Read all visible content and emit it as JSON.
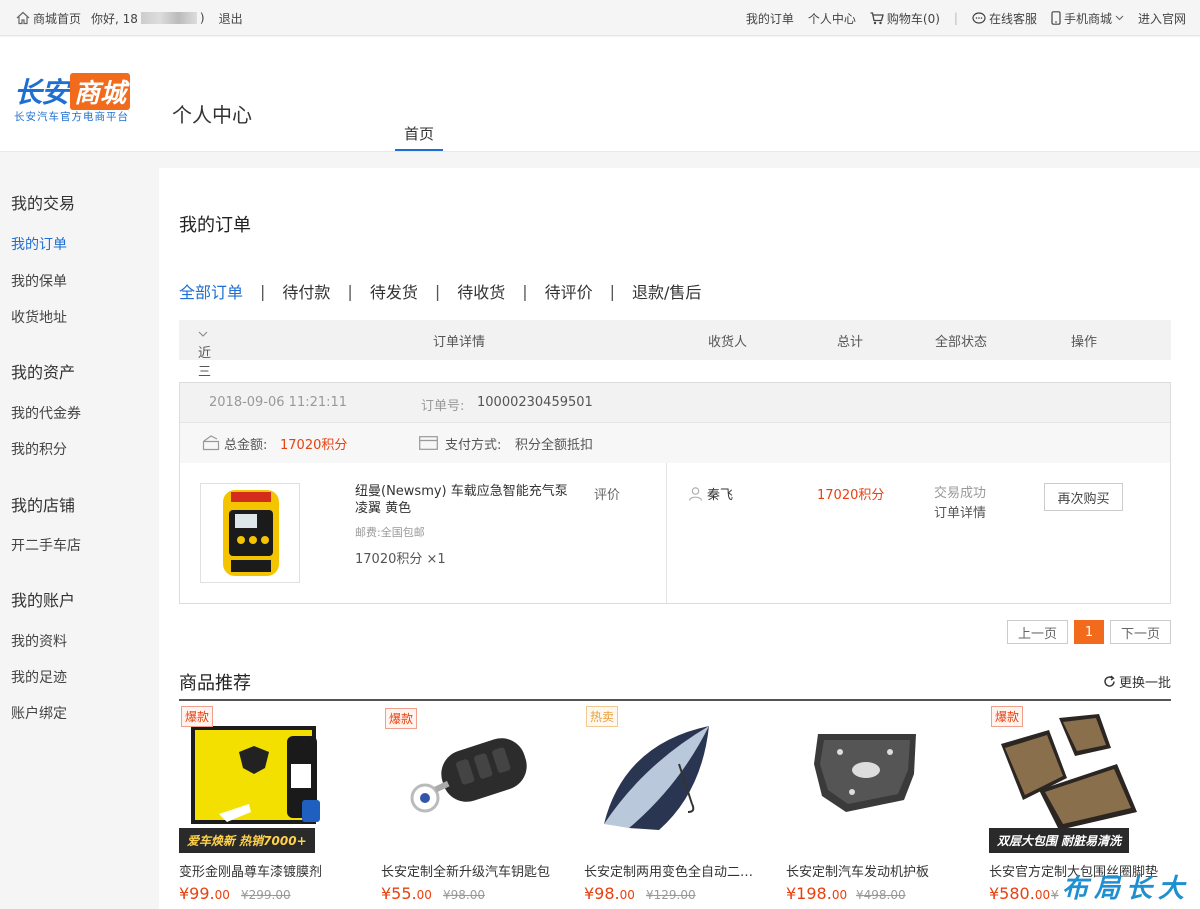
{
  "topbar": {
    "home": "商城首页",
    "greeting": "你好, 18",
    "greeting_end": ")",
    "logout": "退出",
    "my_orders": "我的订单",
    "personal_center": "个人中心",
    "cart": "购物车(0)",
    "sep": "|",
    "service": "在线客服",
    "mobile": "手机商城",
    "official": "进入官网"
  },
  "header": {
    "brand_1": "长安",
    "brand_2": "商城",
    "slogan": "长安汽车官方电商平台",
    "page_heading": "个人中心",
    "nav_home": "首页"
  },
  "sidebar": {
    "groups": [
      {
        "title": "我的交易",
        "items": [
          "我的订单",
          "我的保单",
          "收货地址"
        ]
      },
      {
        "title": "我的资产",
        "items": [
          "我的代金券",
          "我的积分"
        ]
      },
      {
        "title": "我的店铺",
        "items": [
          "开二手车店"
        ]
      },
      {
        "title": "我的账户",
        "items": [
          "我的资料",
          "我的足迹",
          "账户绑定"
        ]
      }
    ],
    "active": "我的订单"
  },
  "main": {
    "title": "我的订单",
    "tabs": [
      "全部订单",
      "待付款",
      "待发货",
      "待收货",
      "待评价",
      "退款/售后"
    ],
    "tab_sep": "|",
    "table_head": {
      "period": "近三个月订单",
      "detail": "订单详情",
      "receiver": "收货人",
      "total": "总计",
      "status": "全部状态",
      "action": "操作"
    },
    "order": {
      "date": "2018-09-06 11:21:11",
      "no_label": "订单号:",
      "no": "10000230459501",
      "amount_label": "总金额:",
      "amount": "17020积分",
      "pay_label": "支付方式:",
      "pay": "积分全额抵扣",
      "product_name": "纽曼(Newsmy) 车载应急智能充气泵 凌翼 黄色",
      "shipping": "邮费:全国包邮",
      "qty": "17020积分 ×1",
      "review": "评价",
      "receiver": "秦飞",
      "total": "17020积分",
      "status": "交易成功",
      "detail_link": "订单详情",
      "rebuy": "再次购买"
    },
    "pager": {
      "prev": "上一页",
      "current": "1",
      "next": "下一页"
    }
  },
  "recommend": {
    "title": "商品推荐",
    "refresh": "更换一批",
    "items": [
      {
        "badge": "爆款",
        "banner": "爱车焕新 热销7000+",
        "name": "变形金刚晶尊车漆镀膜剂",
        "price_int": "¥99.",
        "price_dec": "00",
        "orig": "¥299.00"
      },
      {
        "badge": "爆款",
        "banner": "",
        "name": "长安定制全新升级汽车钥匙包",
        "price_int": "¥55.",
        "price_dec": "00",
        "orig": "¥98.00"
      },
      {
        "badge": "热卖",
        "banner": "",
        "name": "长安定制两用变色全自动二…",
        "price_int": "¥98.",
        "price_dec": "00",
        "orig": "¥129.00"
      },
      {
        "badge": "",
        "banner": "",
        "name": "长安定制汽车发动机护板",
        "price_int": "¥198.",
        "price_dec": "00",
        "orig": "¥498.00"
      },
      {
        "badge": "爆款",
        "banner": "双层大包围 耐脏易清洗",
        "name": "长安官方定制大包围丝圈脚垫",
        "price_int": "¥580.",
        "price_dec": "00",
        "orig": "¥"
      }
    ]
  },
  "watermark": "布局长大"
}
